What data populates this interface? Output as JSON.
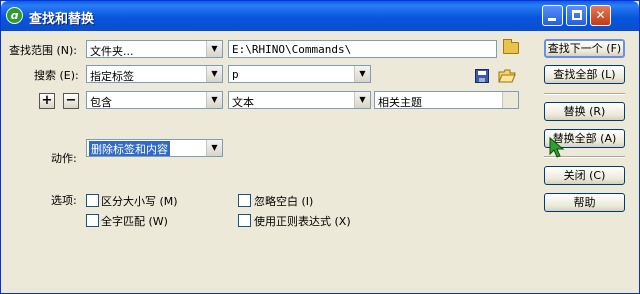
{
  "window": {
    "title": "查找和替换"
  },
  "icons": {
    "app": "dreamweaver-icon",
    "browse": "folder-icon",
    "save_query": "save-icon",
    "load_query": "open-folder-icon"
  },
  "search_in": {
    "label": "查找范围 (N):",
    "scope": "文件夹...",
    "path": "E:\\RHINO\\Commands\\"
  },
  "search": {
    "label": "搜索 (E):",
    "type": "指定标签",
    "tag": "p"
  },
  "condition": {
    "add": "+",
    "remove": "−",
    "operator": "包含",
    "target": "文本",
    "value": "相关主题"
  },
  "action": {
    "label": "动作:",
    "value": "删除标签和内容"
  },
  "options": {
    "label": "选项:",
    "items": [
      "区分大小写 (M)",
      "全字匹配 (W)",
      "忽略空白 (I)",
      "使用正则表达式 (X)"
    ]
  },
  "buttons": {
    "find_next": "查找下一个 (F)",
    "find_all": "查找全部 (L)",
    "replace": "替换 (R)",
    "replace_all": "替换全部 (A)",
    "close": "关闭 (C)",
    "help": "帮助"
  },
  "colors": {
    "titlebar": "#0a5fe8",
    "selection": "#316ac5",
    "face": "#ece9d8"
  }
}
